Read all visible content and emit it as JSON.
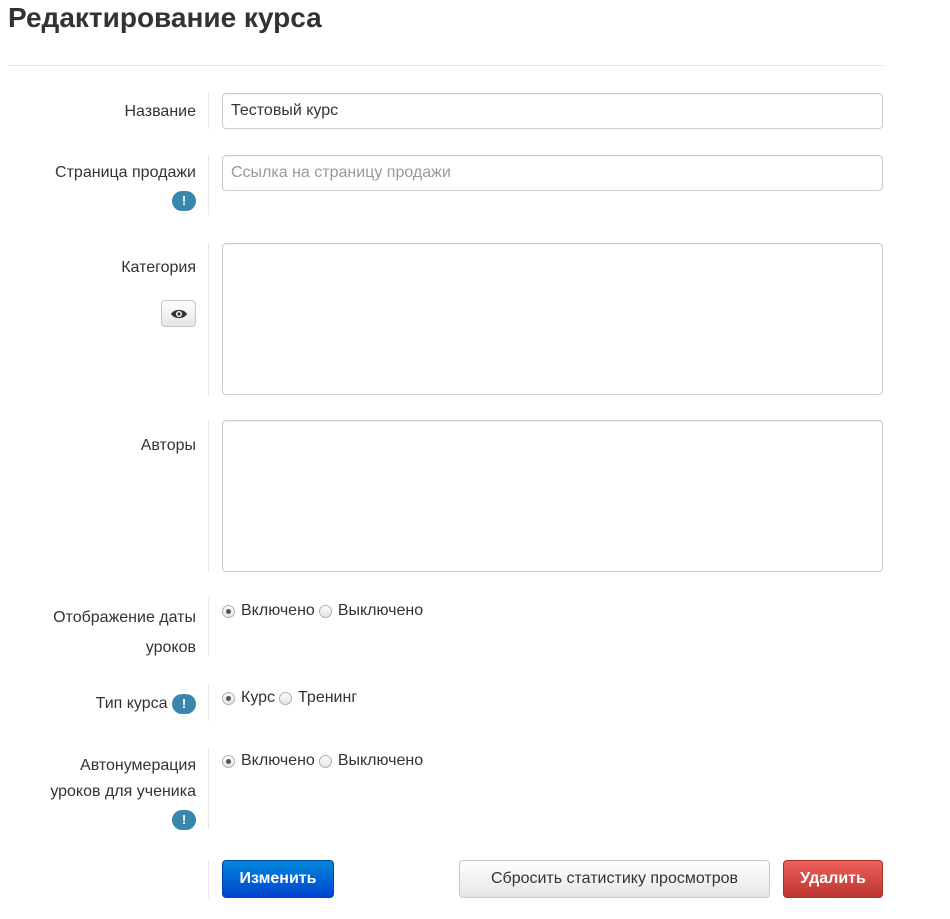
{
  "page": {
    "title": "Редактирование курса"
  },
  "form": {
    "name": {
      "label": "Название",
      "value": "Тестовый курс"
    },
    "sale_page": {
      "label": "Страница продажи",
      "placeholder": "Ссылка на страницу продажи",
      "info": "!"
    },
    "category": {
      "label": "Категория",
      "value": ""
    },
    "authors": {
      "label": "Авторы",
      "value": ""
    },
    "date_display": {
      "label_line1": "Отображение даты",
      "label_line2": "уроков",
      "options": [
        "Включено",
        "Выключено"
      ],
      "selected": "Включено"
    },
    "course_type": {
      "label": "Тип курса",
      "info": "!",
      "options": [
        "Курс",
        "Тренинг"
      ],
      "selected": "Курс"
    },
    "auto_numbering": {
      "label_line1": "Автонумерация",
      "label_line2": "уроков для ученика",
      "info": "!",
      "options": [
        "Включено",
        "Выключено"
      ],
      "selected": "Включено"
    }
  },
  "actions": {
    "save_label": "Изменить",
    "reset_stats_label": "Сбросить статистику просмотров",
    "delete_label": "Удалить"
  },
  "icons": {
    "category_preview": "eye-icon",
    "info": "info-badge-icon"
  },
  "colors": {
    "primary": "#0055cc",
    "danger": "#da4f49",
    "info": "#3a87ad"
  }
}
